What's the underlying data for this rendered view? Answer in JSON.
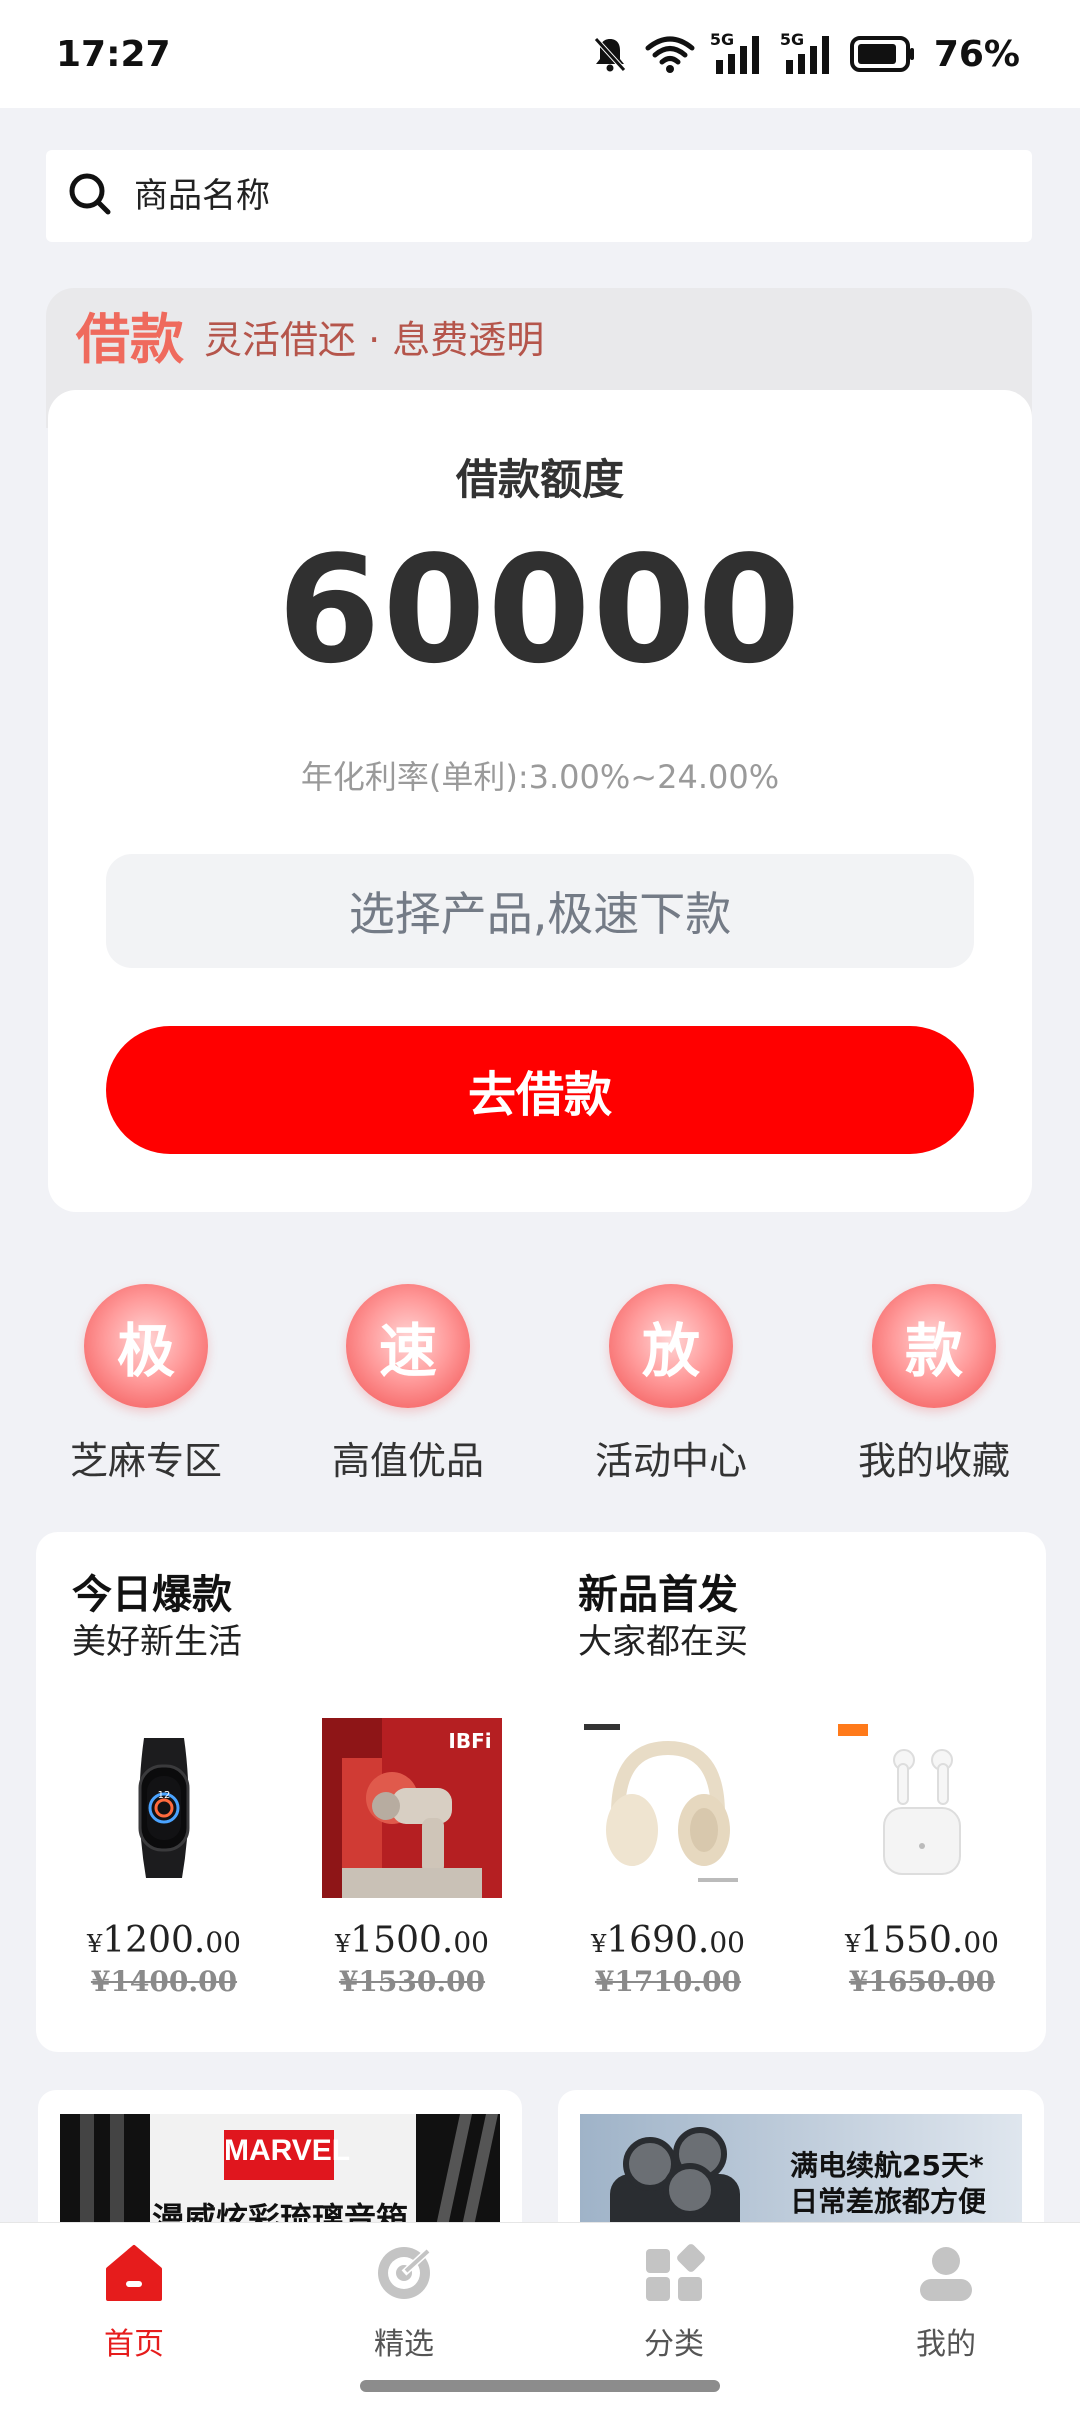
{
  "status_bar": {
    "time": "17:27",
    "network_1": "5G",
    "network_2": "5G",
    "battery": "76%"
  },
  "search": {
    "placeholder": "商品名称"
  },
  "loan": {
    "header_title": "借款",
    "header_subtitle": "灵活借还 · 息费透明",
    "amount_label": "借款额度",
    "amount": "60000",
    "rate": "年化利率(单利):3.00%~24.00%",
    "select_placeholder": "选择产品,极速下款",
    "button_label": "去借款",
    "accent_color": "#ff0000"
  },
  "quick_entries": [
    {
      "glyph": "极",
      "label": "芝麻专区"
    },
    {
      "glyph": "速",
      "label": "高值优品"
    },
    {
      "glyph": "放",
      "label": "活动中心"
    },
    {
      "glyph": "款",
      "label": "我的收藏"
    }
  ],
  "product_panel": {
    "left_title": "今日爆款",
    "left_subtitle": "美好新生活",
    "right_title": "新品首发",
    "right_subtitle": "大家都在买",
    "products": [
      {
        "image": "smart-band",
        "yen": "¥",
        "price_int": "1200.",
        "price_dec": "00",
        "original": "¥1400.00"
      },
      {
        "image": "massage-gun",
        "yen": "¥",
        "price_int": "1500.",
        "price_dec": "00",
        "original": "¥1530.00",
        "image_text": "IBFi"
      },
      {
        "image": "headphones",
        "yen": "¥",
        "price_int": "1690.",
        "price_dec": "00",
        "original": "¥1710.00"
      },
      {
        "image": "earbuds",
        "yen": "¥",
        "price_int": "1550.",
        "price_dec": "00",
        "original": "¥1650.00"
      }
    ]
  },
  "promos": [
    {
      "image": "marvel-speaker",
      "brand": "MARVEL",
      "text": "漫威炫彩琉璃音箱"
    },
    {
      "image": "electric-shaver",
      "line1": "满电续航25天*",
      "line2": "日常差旅都方便"
    }
  ],
  "bottom_nav": [
    {
      "label": "首页",
      "icon": "home-icon",
      "active": true
    },
    {
      "label": "精选",
      "icon": "target-icon",
      "active": false
    },
    {
      "label": "分类",
      "icon": "category-icon",
      "active": false
    },
    {
      "label": "我的",
      "icon": "user-icon",
      "active": false
    }
  ]
}
